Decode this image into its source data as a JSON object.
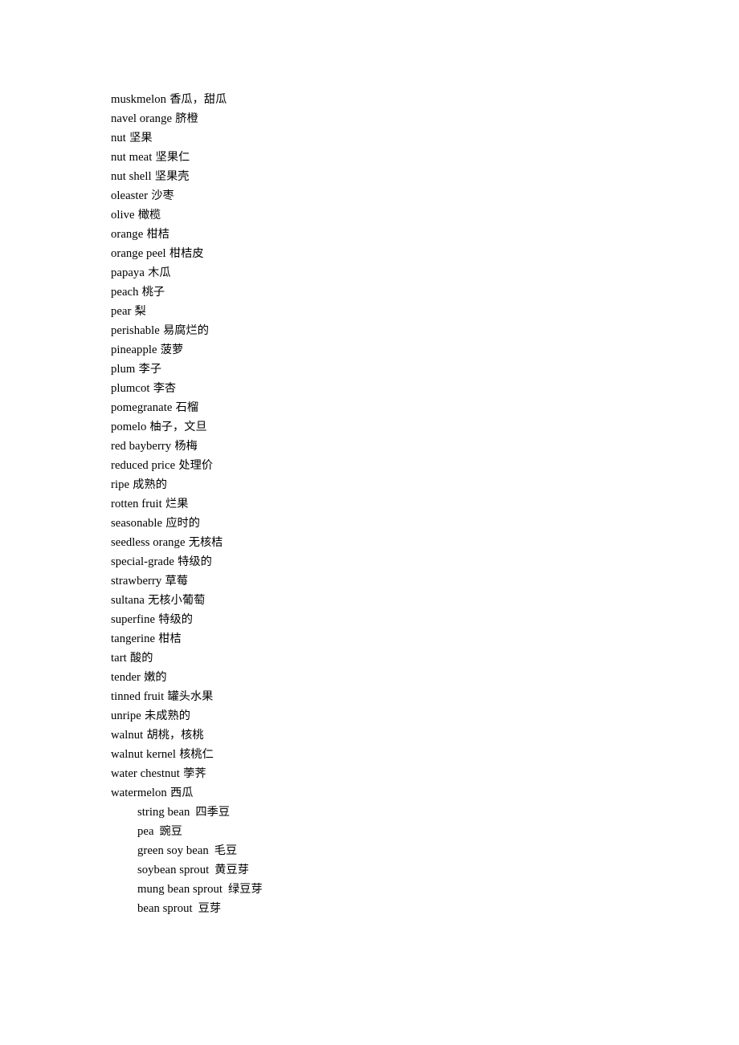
{
  "document": {
    "kind": "vocabulary-glossary",
    "topic_note": "fruits, nuts and bean sprouts English-Chinese word list",
    "page_background": "#ffffff",
    "text_color": "#000000"
  },
  "glossary": {
    "main_list": [
      {
        "term": "muskmelon",
        "gloss": "香瓜，甜瓜"
      },
      {
        "term": "navel orange",
        "gloss": "脐橙"
      },
      {
        "term": "nut",
        "gloss": "坚果"
      },
      {
        "term": "nut meat",
        "gloss": "坚果仁"
      },
      {
        "term": "nut shell",
        "gloss": "坚果壳"
      },
      {
        "term": "oleaster",
        "gloss": "沙枣"
      },
      {
        "term": "olive",
        "gloss": "橄榄"
      },
      {
        "term": "orange",
        "gloss": "柑桔"
      },
      {
        "term": "orange peel",
        "gloss": "柑桔皮"
      },
      {
        "term": "papaya",
        "gloss": "木瓜"
      },
      {
        "term": "peach",
        "gloss": "桃子"
      },
      {
        "term": "pear",
        "gloss": "梨"
      },
      {
        "term": "perishable",
        "gloss": "易腐烂的"
      },
      {
        "term": "pineapple",
        "gloss": "菠萝"
      },
      {
        "term": "plum",
        "gloss": "李子"
      },
      {
        "term": "plumcot",
        "gloss": "李杏"
      },
      {
        "term": "pomegranate",
        "gloss": "石榴"
      },
      {
        "term": "pomelo",
        "gloss": "柚子，文旦"
      },
      {
        "term": "red bayberry",
        "gloss": "杨梅"
      },
      {
        "term": "reduced price",
        "gloss": "处理价"
      },
      {
        "term": "ripe",
        "gloss": "成熟的"
      },
      {
        "term": "rotten fruit",
        "gloss": "烂果"
      },
      {
        "term": "seasonable",
        "gloss": "应时的"
      },
      {
        "term": "seedless orange",
        "gloss": "无核桔"
      },
      {
        "term": "special-grade",
        "gloss": "特级的"
      },
      {
        "term": "strawberry",
        "gloss": "草莓"
      },
      {
        "term": "sultana",
        "gloss": "无核小葡萄"
      },
      {
        "term": "superfine",
        "gloss": "特级的"
      },
      {
        "term": "tangerine",
        "gloss": "柑桔"
      },
      {
        "term": "tart",
        "gloss": "酸的"
      },
      {
        "term": "tender",
        "gloss": "嫩的"
      },
      {
        "term": "tinned fruit",
        "gloss": "罐头水果"
      },
      {
        "term": "unripe",
        "gloss": "未成熟的"
      },
      {
        "term": "walnut",
        "gloss": "胡桃，核桃"
      },
      {
        "term": "walnut kernel",
        "gloss": "核桃仁"
      },
      {
        "term": "water chestnut",
        "gloss": "荸荠"
      },
      {
        "term": "watermelon",
        "gloss": "西瓜"
      }
    ],
    "indented_list": [
      {
        "term": "string bean",
        "gloss": "四季豆"
      },
      {
        "term": "pea",
        "gloss": "豌豆"
      },
      {
        "term": "green soy bean",
        "gloss": "毛豆"
      },
      {
        "term": "soybean sprout",
        "gloss": "黄豆芽"
      },
      {
        "term": "mung bean sprout",
        "gloss": "绿豆芽"
      },
      {
        "term": "bean sprout",
        "gloss": "豆芽"
      }
    ]
  }
}
